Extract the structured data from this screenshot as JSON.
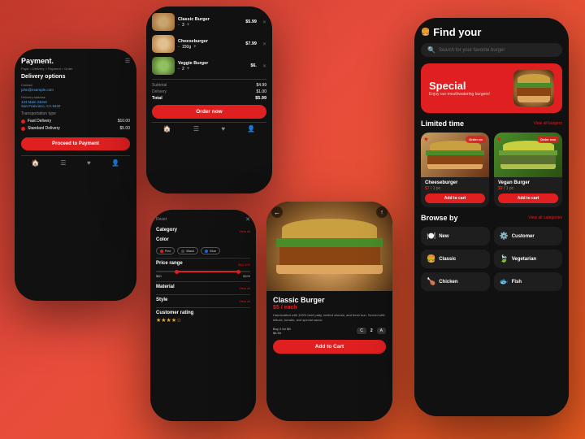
{
  "background": {
    "gradient_start": "#c0392b",
    "gradient_end": "#e8a020"
  },
  "phone_payment": {
    "app_title": "Payment.",
    "breadcrumb": "Paytr > Delivery > Payment > Order",
    "section_title": "Delivery options",
    "contact_label": "Contact",
    "contact_value": "john@example.com",
    "address_label": "Delivery address",
    "address_value": "123 Main Street\nSan Francisco, CA 5432",
    "transport_label": "Transportation type",
    "fast_delivery": "Fast Delivery",
    "fast_price": "$10.00",
    "standard_delivery": "Standard Delivery",
    "standard_price": "$5.00",
    "proceed_btn": "Proceed to Payment",
    "nav_icons": [
      "🏠",
      "☰",
      "♥",
      "👤"
    ]
  },
  "phone_cart": {
    "items": [
      {
        "name": "Classic Burger",
        "qty": "3",
        "price": "$5.99"
      },
      {
        "name": "Cheeseburger",
        "qty": "150g",
        "price": "$7.99"
      },
      {
        "name": "Veggie Burger",
        "qty": "2",
        "price": "$6."
      }
    ],
    "subtotal_label": "Subtotal",
    "subtotal_val": "$4.99",
    "delivery_label": "Delivery",
    "delivery_val": "$1.00",
    "total_label": "Total",
    "total_val": "$5.99",
    "order_btn": "Order now",
    "nav_icons": [
      "🏠",
      "☰",
      "♥",
      "👤"
    ]
  },
  "phone_filter": {
    "reset_label": "Reset",
    "close_icon": "✕",
    "category_label": "Category",
    "view_all": "View all",
    "color_label": "Color",
    "colors": [
      {
        "label": "Red",
        "color": "#e02020"
      },
      {
        "label": "Black",
        "color": "#222"
      },
      {
        "label": "Blue",
        "color": "#2060e0"
      }
    ],
    "price_label": "Price range",
    "price_range": "$10-100",
    "price_min": "$50",
    "price_max": "$100",
    "material_label": "Material",
    "style_label": "Style",
    "customer_rating_label": "Customer rating"
  },
  "phone_detail": {
    "back_icon": "←",
    "share_icon": "↑",
    "burger_name": "Classic Burger",
    "price": "$5 / each",
    "description": "Handcrafted with 100% beef patty, melted cheese, and fresh bun. Served with lettuce, tomato, and special sauce.",
    "offer": "Buy 2 for $9",
    "offer_price": "$4.50",
    "qty_controls": [
      "C",
      "2",
      "A"
    ],
    "add_to_cart_btn": "Add to Cart"
  },
  "phone_main": {
    "logo_icon": "🍔",
    "title": "Find your",
    "search_placeholder": "Search for your favorite burger",
    "special_tag": "Special",
    "special_desc": "Enjoy our mouthwatering burgers!",
    "limited_section": "Limited time",
    "view_all_burgers": "View all burgers",
    "cards": [
      {
        "name": "Cheeseburger",
        "price_old": "$$",
        "price": "$7",
        "per": "1 pc",
        "add_btn": "Add to cart",
        "order_badge": "Order no"
      },
      {
        "name": "Vegan Burger",
        "price_old": "$$",
        "price": "$9",
        "per": "1 pc",
        "add_btn": "Add to cart",
        "order_badge": "Order nov"
      }
    ],
    "browse_section": "Browse by",
    "view_all_categories": "View all categories",
    "categories": [
      {
        "icon": "🍽️",
        "label": "New"
      },
      {
        "icon": "⚙️",
        "label": "Customer"
      },
      {
        "icon": "🍔",
        "label": "Classic"
      },
      {
        "icon": "🍃",
        "label": "Vegetarian"
      },
      {
        "icon": "🍗",
        "label": "Chicken"
      },
      {
        "icon": "🐟",
        "label": "Fish"
      }
    ]
  }
}
